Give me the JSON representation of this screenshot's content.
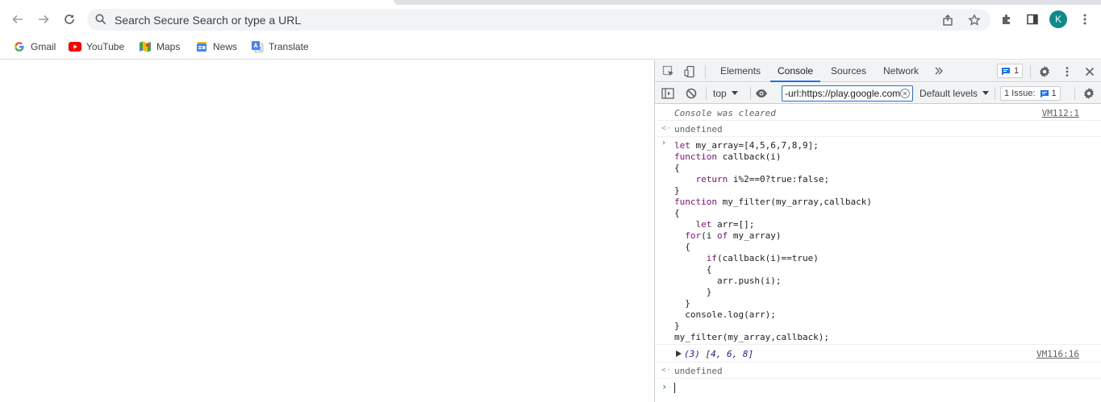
{
  "browser": {
    "omnibox_placeholder": "Search Secure Search or type a URL",
    "avatar_letter": "K",
    "bookmarks": [
      {
        "label": "Gmail",
        "icon": "gmail-icon"
      },
      {
        "label": "YouTube",
        "icon": "youtube-icon"
      },
      {
        "label": "Maps",
        "icon": "maps-icon"
      },
      {
        "label": "News",
        "icon": "news-icon"
      },
      {
        "label": "Translate",
        "icon": "translate-icon"
      }
    ]
  },
  "devtools": {
    "tabs": [
      "Elements",
      "Console",
      "Sources",
      "Network"
    ],
    "active_tab": "Console",
    "messages_badge": "1",
    "context": "top",
    "filter_value": "-url:https://play.google.com",
    "levels": "Default levels",
    "issues_label": "1 Issue:",
    "issues_count": "1"
  },
  "console": {
    "cleared_text": "Console was cleared",
    "cleared_source": "VM112:1",
    "undefined1": "undefined",
    "code_lines": [
      "let my_array=[4,5,6,7,8,9];",
      "function callback(i)",
      "{",
      "    return i%2==0?true:false;",
      "}",
      "function my_filter(my_array,callback)",
      "{",
      "    let arr=[];",
      "  for(i of my_array)",
      "  {",
      "      if(callback(i)==true)",
      "      {",
      "        arr.push(i);",
      "      }",
      "  }",
      "  console.log(arr);",
      "}",
      "my_filter(my_array,callback);"
    ],
    "result_text": "(3) [4, 6, 8]",
    "result_source": "VM116:16",
    "undefined2": "undefined"
  },
  "colors": {
    "accent": "#1a73e8",
    "keyword": "#881280",
    "avatar": "#0e8a8a"
  }
}
